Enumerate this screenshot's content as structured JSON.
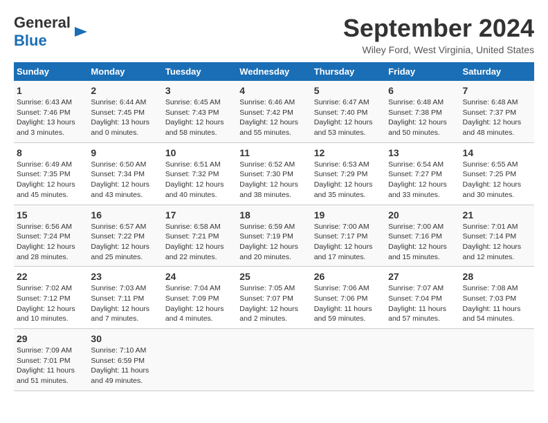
{
  "header": {
    "logo_line1": "General",
    "logo_line2": "Blue",
    "title": "September 2024",
    "subtitle": "Wiley Ford, West Virginia, United States"
  },
  "calendar": {
    "columns": [
      "Sunday",
      "Monday",
      "Tuesday",
      "Wednesday",
      "Thursday",
      "Friday",
      "Saturday"
    ],
    "weeks": [
      [
        {
          "day": "1",
          "info": "Sunrise: 6:43 AM\nSunset: 7:46 PM\nDaylight: 13 hours\nand 3 minutes."
        },
        {
          "day": "2",
          "info": "Sunrise: 6:44 AM\nSunset: 7:45 PM\nDaylight: 13 hours\nand 0 minutes."
        },
        {
          "day": "3",
          "info": "Sunrise: 6:45 AM\nSunset: 7:43 PM\nDaylight: 12 hours\nand 58 minutes."
        },
        {
          "day": "4",
          "info": "Sunrise: 6:46 AM\nSunset: 7:42 PM\nDaylight: 12 hours\nand 55 minutes."
        },
        {
          "day": "5",
          "info": "Sunrise: 6:47 AM\nSunset: 7:40 PM\nDaylight: 12 hours\nand 53 minutes."
        },
        {
          "day": "6",
          "info": "Sunrise: 6:48 AM\nSunset: 7:38 PM\nDaylight: 12 hours\nand 50 minutes."
        },
        {
          "day": "7",
          "info": "Sunrise: 6:48 AM\nSunset: 7:37 PM\nDaylight: 12 hours\nand 48 minutes."
        }
      ],
      [
        {
          "day": "8",
          "info": "Sunrise: 6:49 AM\nSunset: 7:35 PM\nDaylight: 12 hours\nand 45 minutes."
        },
        {
          "day": "9",
          "info": "Sunrise: 6:50 AM\nSunset: 7:34 PM\nDaylight: 12 hours\nand 43 minutes."
        },
        {
          "day": "10",
          "info": "Sunrise: 6:51 AM\nSunset: 7:32 PM\nDaylight: 12 hours\nand 40 minutes."
        },
        {
          "day": "11",
          "info": "Sunrise: 6:52 AM\nSunset: 7:30 PM\nDaylight: 12 hours\nand 38 minutes."
        },
        {
          "day": "12",
          "info": "Sunrise: 6:53 AM\nSunset: 7:29 PM\nDaylight: 12 hours\nand 35 minutes."
        },
        {
          "day": "13",
          "info": "Sunrise: 6:54 AM\nSunset: 7:27 PM\nDaylight: 12 hours\nand 33 minutes."
        },
        {
          "day": "14",
          "info": "Sunrise: 6:55 AM\nSunset: 7:25 PM\nDaylight: 12 hours\nand 30 minutes."
        }
      ],
      [
        {
          "day": "15",
          "info": "Sunrise: 6:56 AM\nSunset: 7:24 PM\nDaylight: 12 hours\nand 28 minutes."
        },
        {
          "day": "16",
          "info": "Sunrise: 6:57 AM\nSunset: 7:22 PM\nDaylight: 12 hours\nand 25 minutes."
        },
        {
          "day": "17",
          "info": "Sunrise: 6:58 AM\nSunset: 7:21 PM\nDaylight: 12 hours\nand 22 minutes."
        },
        {
          "day": "18",
          "info": "Sunrise: 6:59 AM\nSunset: 7:19 PM\nDaylight: 12 hours\nand 20 minutes."
        },
        {
          "day": "19",
          "info": "Sunrise: 7:00 AM\nSunset: 7:17 PM\nDaylight: 12 hours\nand 17 minutes."
        },
        {
          "day": "20",
          "info": "Sunrise: 7:00 AM\nSunset: 7:16 PM\nDaylight: 12 hours\nand 15 minutes."
        },
        {
          "day": "21",
          "info": "Sunrise: 7:01 AM\nSunset: 7:14 PM\nDaylight: 12 hours\nand 12 minutes."
        }
      ],
      [
        {
          "day": "22",
          "info": "Sunrise: 7:02 AM\nSunset: 7:12 PM\nDaylight: 12 hours\nand 10 minutes."
        },
        {
          "day": "23",
          "info": "Sunrise: 7:03 AM\nSunset: 7:11 PM\nDaylight: 12 hours\nand 7 minutes."
        },
        {
          "day": "24",
          "info": "Sunrise: 7:04 AM\nSunset: 7:09 PM\nDaylight: 12 hours\nand 4 minutes."
        },
        {
          "day": "25",
          "info": "Sunrise: 7:05 AM\nSunset: 7:07 PM\nDaylight: 12 hours\nand 2 minutes."
        },
        {
          "day": "26",
          "info": "Sunrise: 7:06 AM\nSunset: 7:06 PM\nDaylight: 11 hours\nand 59 minutes."
        },
        {
          "day": "27",
          "info": "Sunrise: 7:07 AM\nSunset: 7:04 PM\nDaylight: 11 hours\nand 57 minutes."
        },
        {
          "day": "28",
          "info": "Sunrise: 7:08 AM\nSunset: 7:03 PM\nDaylight: 11 hours\nand 54 minutes."
        }
      ],
      [
        {
          "day": "29",
          "info": "Sunrise: 7:09 AM\nSunset: 7:01 PM\nDaylight: 11 hours\nand 51 minutes."
        },
        {
          "day": "30",
          "info": "Sunrise: 7:10 AM\nSunset: 6:59 PM\nDaylight: 11 hours\nand 49 minutes."
        },
        {
          "day": "",
          "info": ""
        },
        {
          "day": "",
          "info": ""
        },
        {
          "day": "",
          "info": ""
        },
        {
          "day": "",
          "info": ""
        },
        {
          "day": "",
          "info": ""
        }
      ]
    ]
  }
}
